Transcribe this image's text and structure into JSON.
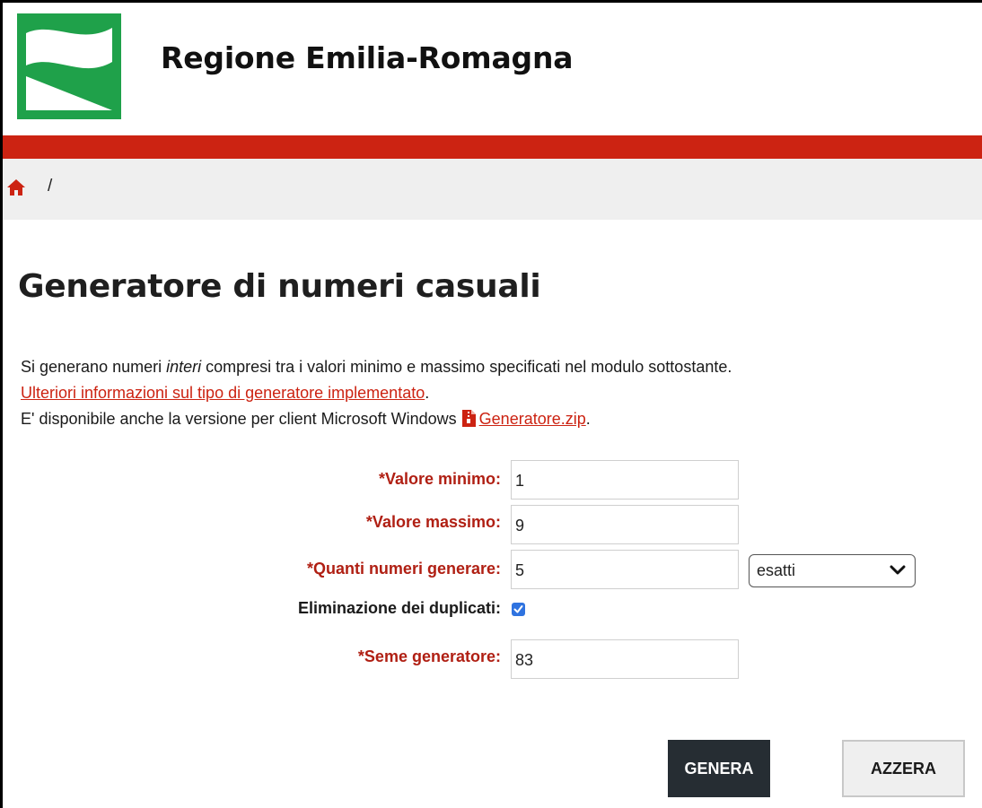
{
  "header": {
    "site_title": "Regione Emilia-Romagna",
    "logo_icon": "regione-emilia-romagna-logo",
    "accent_color": "#cc2312",
    "logo_color": "#1fa14a"
  },
  "breadcrumb": {
    "home_icon": "home-icon",
    "separator": "/"
  },
  "main": {
    "title": "Generatore di numeri casuali",
    "intro": {
      "line1_before": "Si generano numeri ",
      "line1_em": "interi",
      "line1_after": " compresi tra i valori minimo e massimo specificati nel modulo sottostante.",
      "info_link": "Ulteriori informazioni sul tipo di generatore implementato",
      "info_link_after": ".",
      "line3_before": "E' disponibile anche la versione per client Microsoft Windows",
      "zip_icon": "zip-file-icon",
      "zip_link": "Generatore.zip",
      "zip_after": "."
    }
  },
  "form": {
    "min_label": "*Valore minimo:",
    "min_value": "1",
    "max_label": "*Valore massimo:",
    "max_value": "9",
    "count_label": "*Quanti numeri generare:",
    "count_value": "5",
    "count_mode": "esatti",
    "dedup_label": "Eliminazione dei duplicati:",
    "dedup_checked": true,
    "seed_label": "*Seme generatore:",
    "seed_value": "83",
    "generate_label": "GENERA",
    "reset_label": "AZZERA"
  }
}
